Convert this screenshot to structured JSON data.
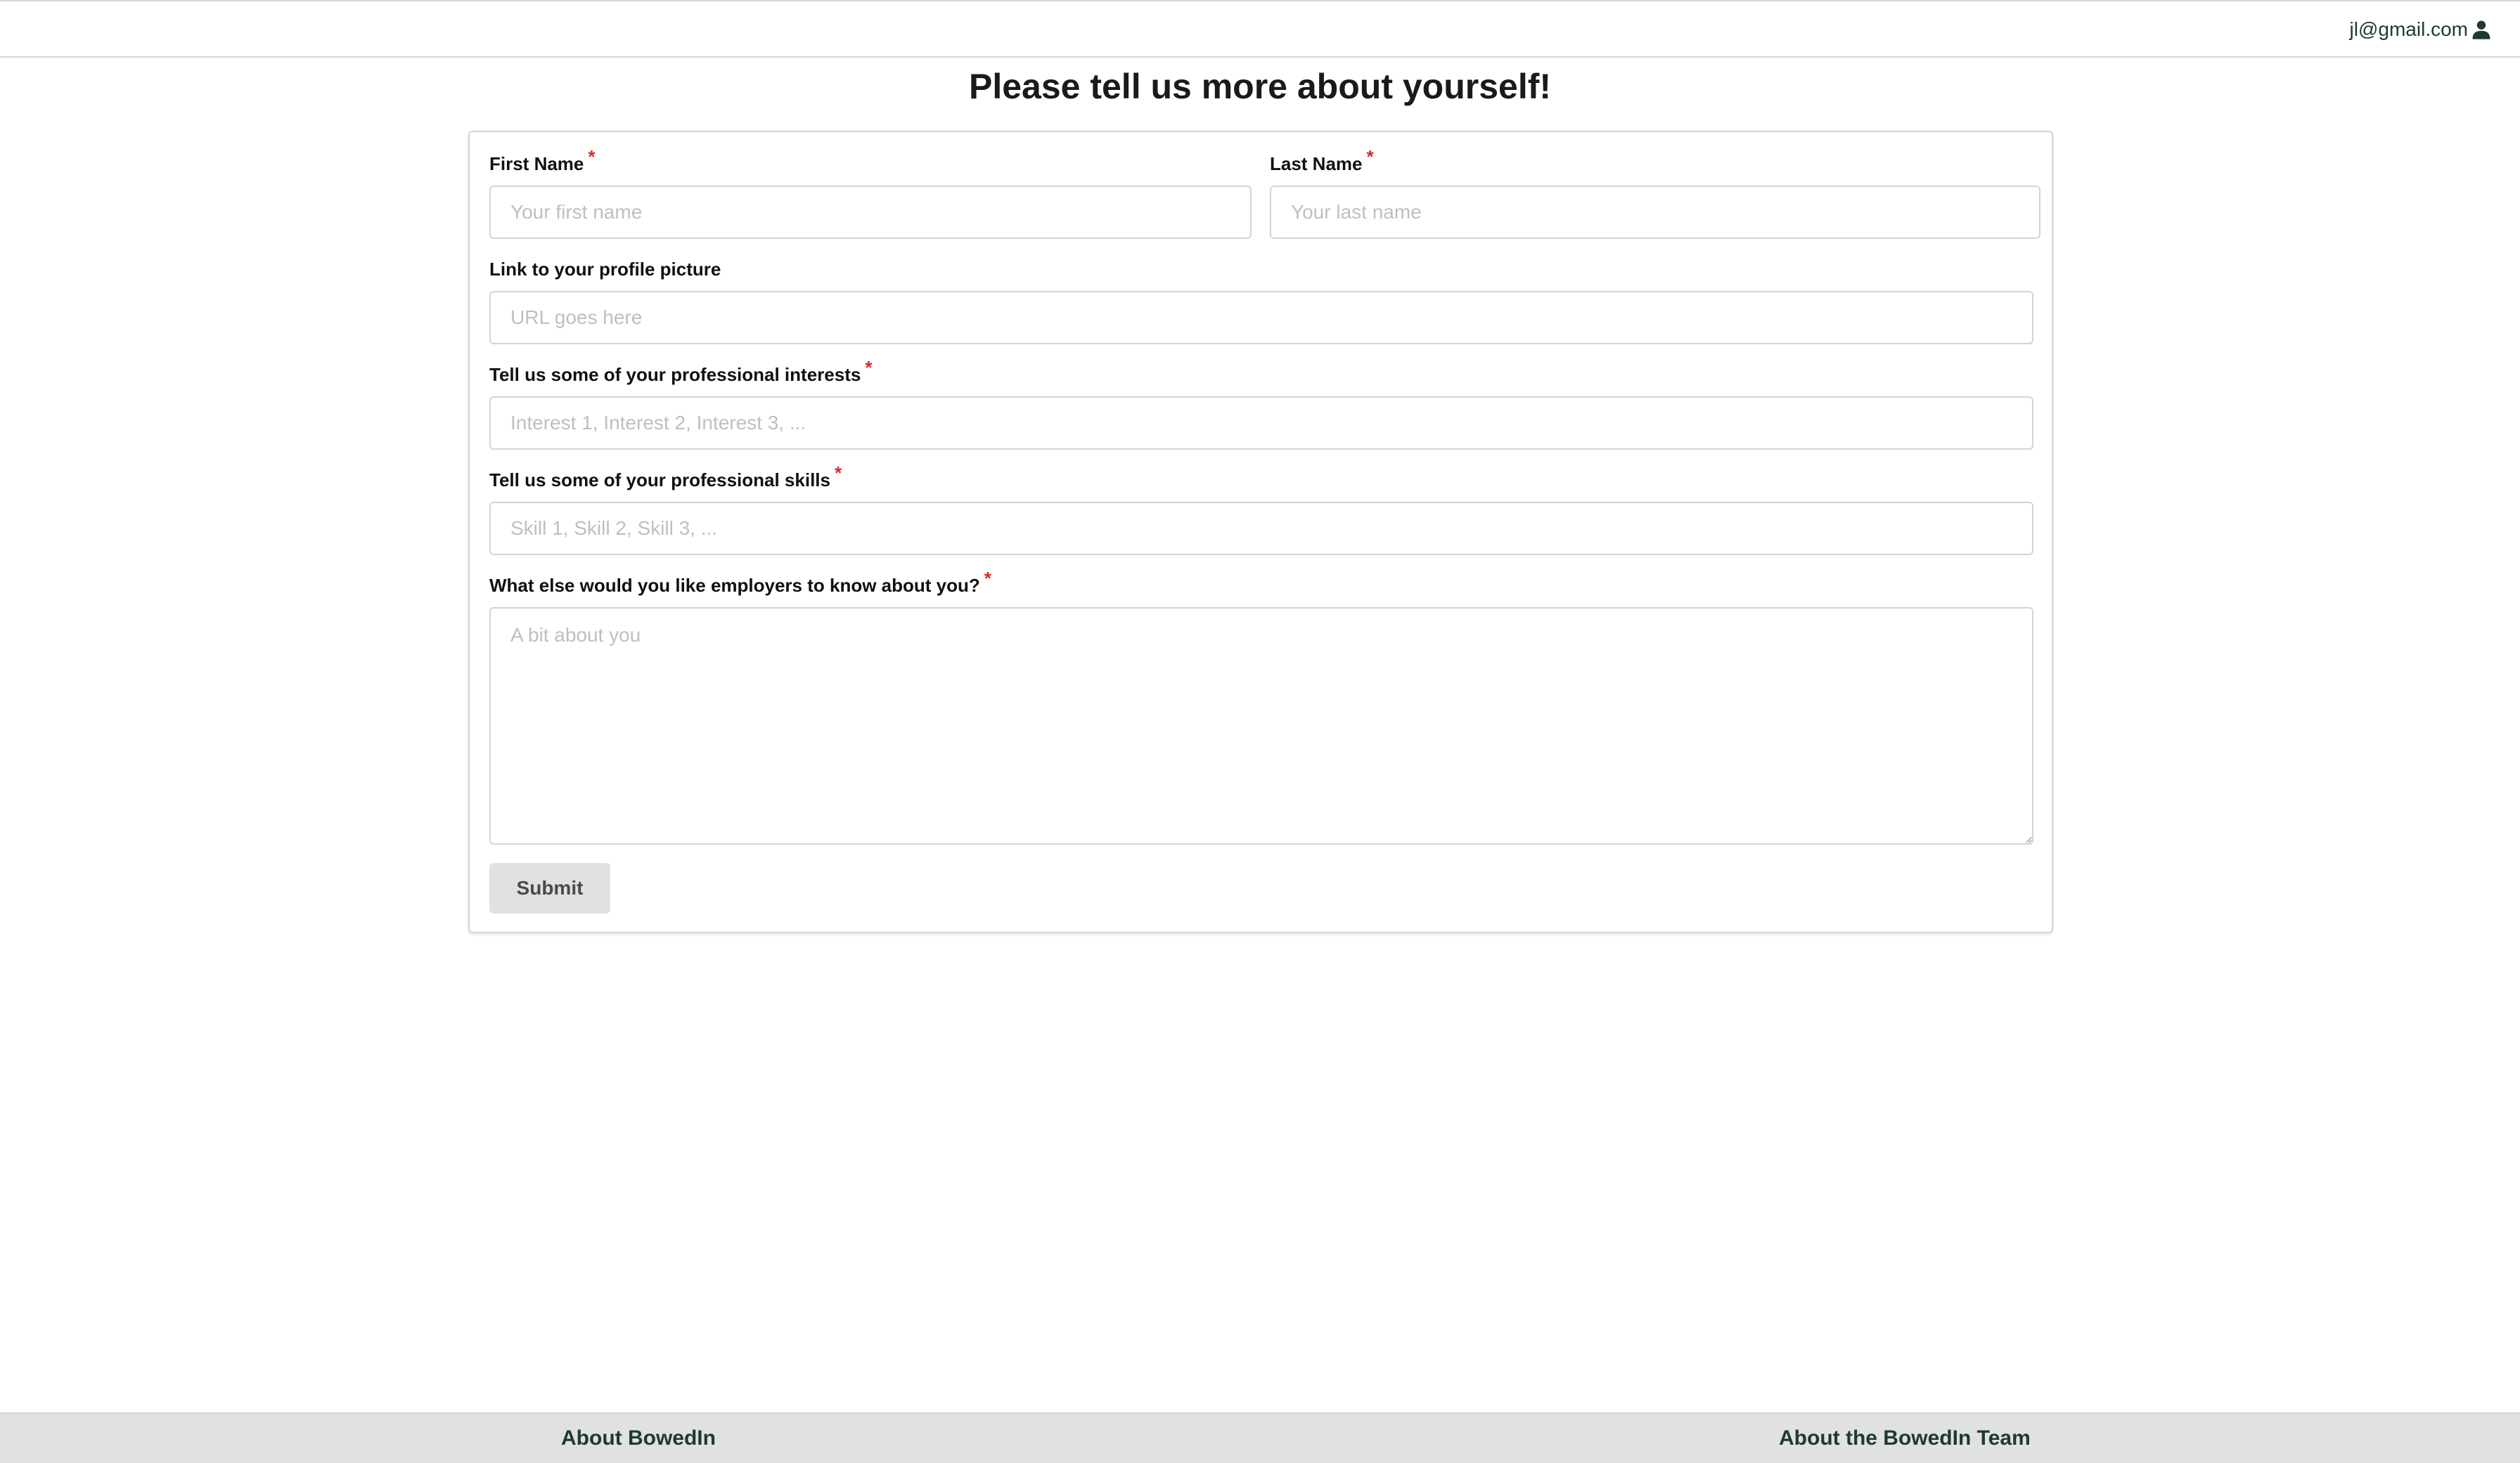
{
  "header": {
    "user_email": "jl@gmail.com",
    "user_icon": "user-icon"
  },
  "page": {
    "title": "Please tell us more about yourself!"
  },
  "form": {
    "first_name": {
      "label": "First Name",
      "required": true,
      "placeholder": "Your first name",
      "value": ""
    },
    "last_name": {
      "label": "Last Name",
      "required": true,
      "placeholder": "Your last name",
      "value": ""
    },
    "picture": {
      "label": "Link to your profile picture",
      "required": false,
      "placeholder": "URL goes here",
      "value": ""
    },
    "interests": {
      "label": "Tell us some of your professional interests",
      "required": true,
      "placeholder": "Interest 1, Interest 2, Interest 3, ...",
      "value": ""
    },
    "skills": {
      "label": "Tell us some of your professional skills",
      "required": true,
      "placeholder": "Skill 1, Skill 2, Skill 3, ...",
      "value": ""
    },
    "bio": {
      "label": "What else would you like employers to know about you?",
      "required": true,
      "placeholder": "A bit about you",
      "value": ""
    },
    "required_marker": "*",
    "submit_label": "Submit"
  },
  "footer": {
    "about_label": "About BowedIn",
    "team_label": "About the BowedIn Team"
  },
  "colors": {
    "accent_dark_green": "#1e3b2a",
    "required_red": "#db2828",
    "footer_bg": "#e0e1e2",
    "border": "#d4d4d5"
  }
}
